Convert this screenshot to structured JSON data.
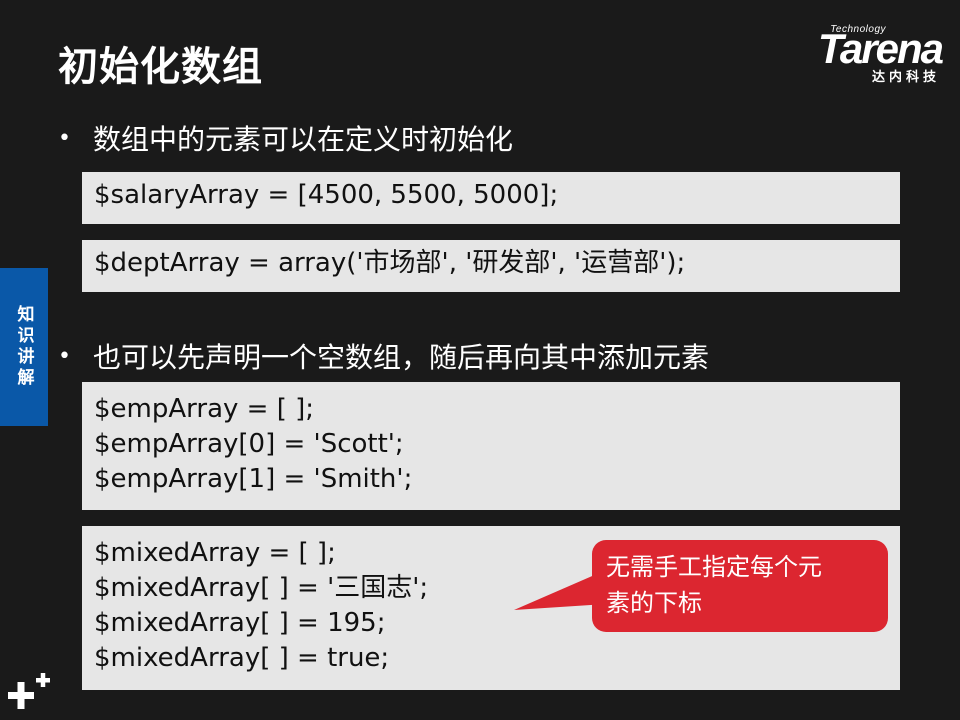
{
  "slide": {
    "title": "初始化数组",
    "side_tab": "知识讲解",
    "colors": {
      "background": "#1a1a1a",
      "side_tab": "#0a58a8",
      "code_bg": "#e6e6e6",
      "callout": "#dc2630"
    }
  },
  "logo": {
    "tech": "Technology",
    "word": "Tarena",
    "cn": "达内科技"
  },
  "bullets": [
    {
      "text": "数组中的元素可以在定义时初始化"
    },
    {
      "text": "也可以先声明一个空数组，随后再向其中添加元素"
    }
  ],
  "code_blocks": [
    {
      "lines": [
        "$salaryArray  = [4500, 5500, 5000];"
      ]
    },
    {
      "lines": [
        "$deptArray = array('市场部', '研发部', '运营部');"
      ]
    },
    {
      "lines": [
        "$empArray  = [ ];",
        "$empArray[0]  = 'Scott';",
        "$empArray[1]  = 'Smith';"
      ]
    },
    {
      "lines": [
        "$mixedArray  = [ ];",
        "$mixedArray[ ] = '三国志';",
        "$mixedArray[ ] = 195;",
        "$mixedArray[ ] = true;"
      ]
    }
  ],
  "callout": {
    "lines": [
      "无需手工指定每个元",
      "素的下标"
    ]
  },
  "icons": {
    "corner": "plus-icon"
  }
}
